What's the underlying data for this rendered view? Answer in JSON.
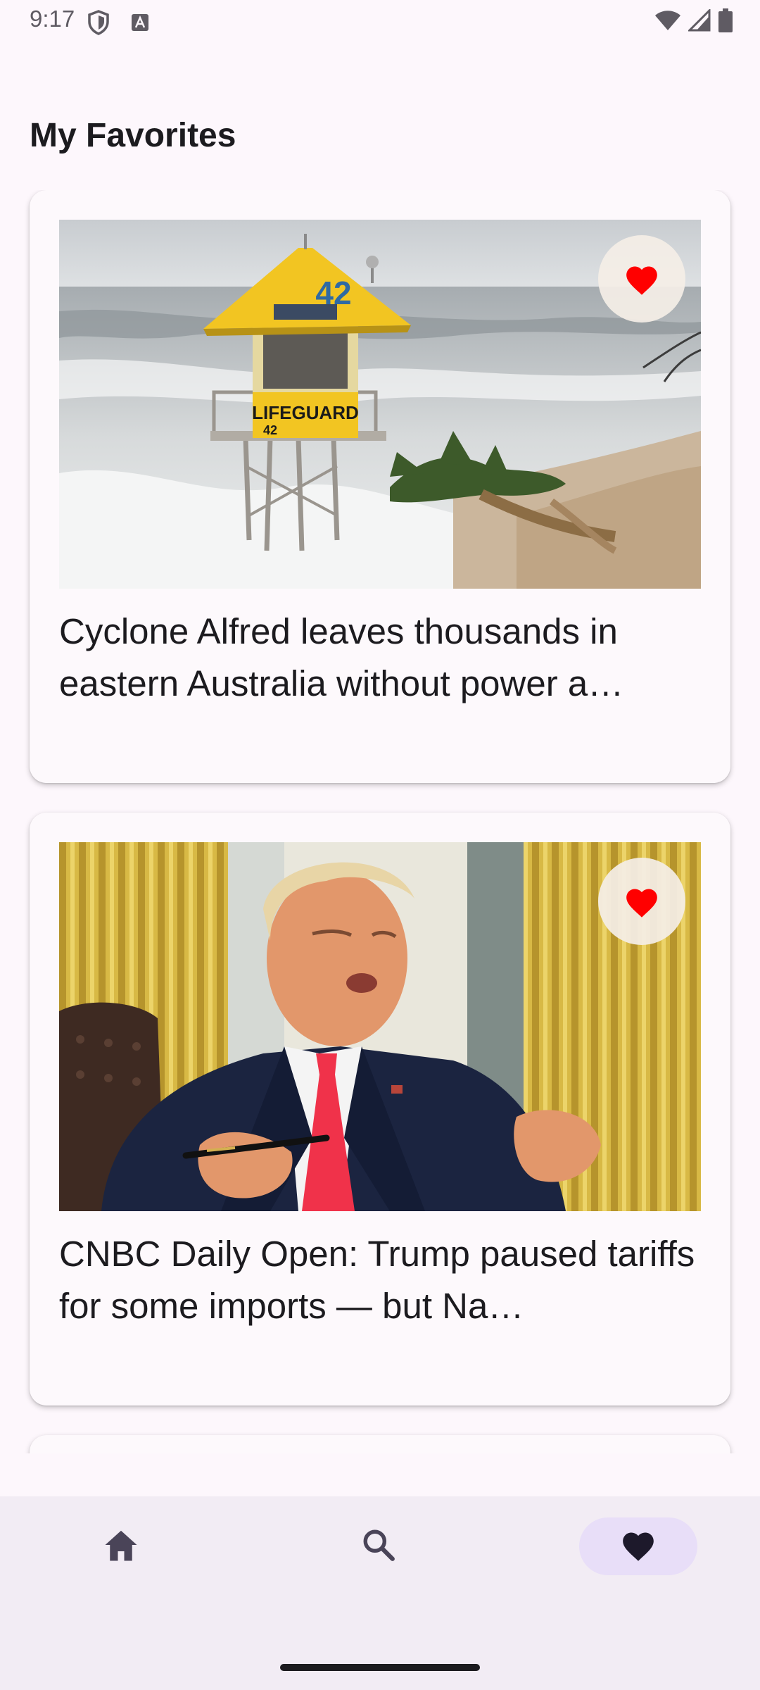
{
  "status_bar": {
    "time": "9:17",
    "icons": [
      "shield-icon",
      "font-a-icon",
      "wifi-icon",
      "signal-icon",
      "battery-icon"
    ]
  },
  "page": {
    "title": "My Favorites"
  },
  "articles": [
    {
      "title": "Cyclone Alfred leaves thousands in eastern Australia without power a…",
      "image_icon": "lifeguard-tower-photo",
      "image_sign": "LIFEGUARD",
      "image_number": "42",
      "favorite": true,
      "favorite_icon": "heart-icon"
    },
    {
      "title": "CNBC Daily Open: Trump paused tariffs for some imports — but Na…",
      "image_icon": "press-photo",
      "favorite": true,
      "favorite_icon": "heart-icon"
    }
  ],
  "bottom_nav": {
    "items": [
      {
        "id": "home",
        "icon": "home-icon",
        "selected": false
      },
      {
        "id": "search",
        "icon": "search-icon",
        "selected": false
      },
      {
        "id": "favorites",
        "icon": "heart-icon",
        "selected": true
      }
    ],
    "selected_color": "#e8def8"
  },
  "colors": {
    "background": "#fdf7fc",
    "nav_background": "#f2ecf4",
    "heart": "#ff0000",
    "text": "#1c1b1f"
  }
}
